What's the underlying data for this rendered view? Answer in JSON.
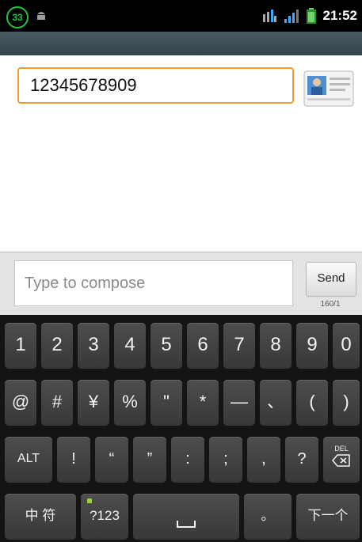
{
  "status_bar": {
    "notification_count": "33",
    "time": "21:52",
    "icons": [
      "android-icon",
      "bluetooth-icon",
      "signal-icon",
      "battery-icon"
    ]
  },
  "message": {
    "recipient": "12345678909",
    "contact_icon": "contact-card-icon"
  },
  "compose": {
    "placeholder": "Type to compose",
    "send_label": "Send",
    "counter": "160/1"
  },
  "keyboard": {
    "row1": [
      "1",
      "2",
      "3",
      "4",
      "5",
      "6",
      "7",
      "8",
      "9",
      "0"
    ],
    "row2": [
      "@",
      "#",
      "¥",
      "%",
      "\"",
      "*",
      "—",
      "、",
      "(",
      ")"
    ],
    "row3": [
      "ALT",
      "!",
      "“",
      "”",
      ":",
      ";",
      ",",
      "?",
      "DEL"
    ],
    "row4": [
      "中 符",
      "?123",
      "space",
      "。",
      "下一个"
    ]
  },
  "colors": {
    "accent_focus": "#f39a2c",
    "title_strip": "#3b4a53",
    "keyboard_bg": "#141414"
  }
}
